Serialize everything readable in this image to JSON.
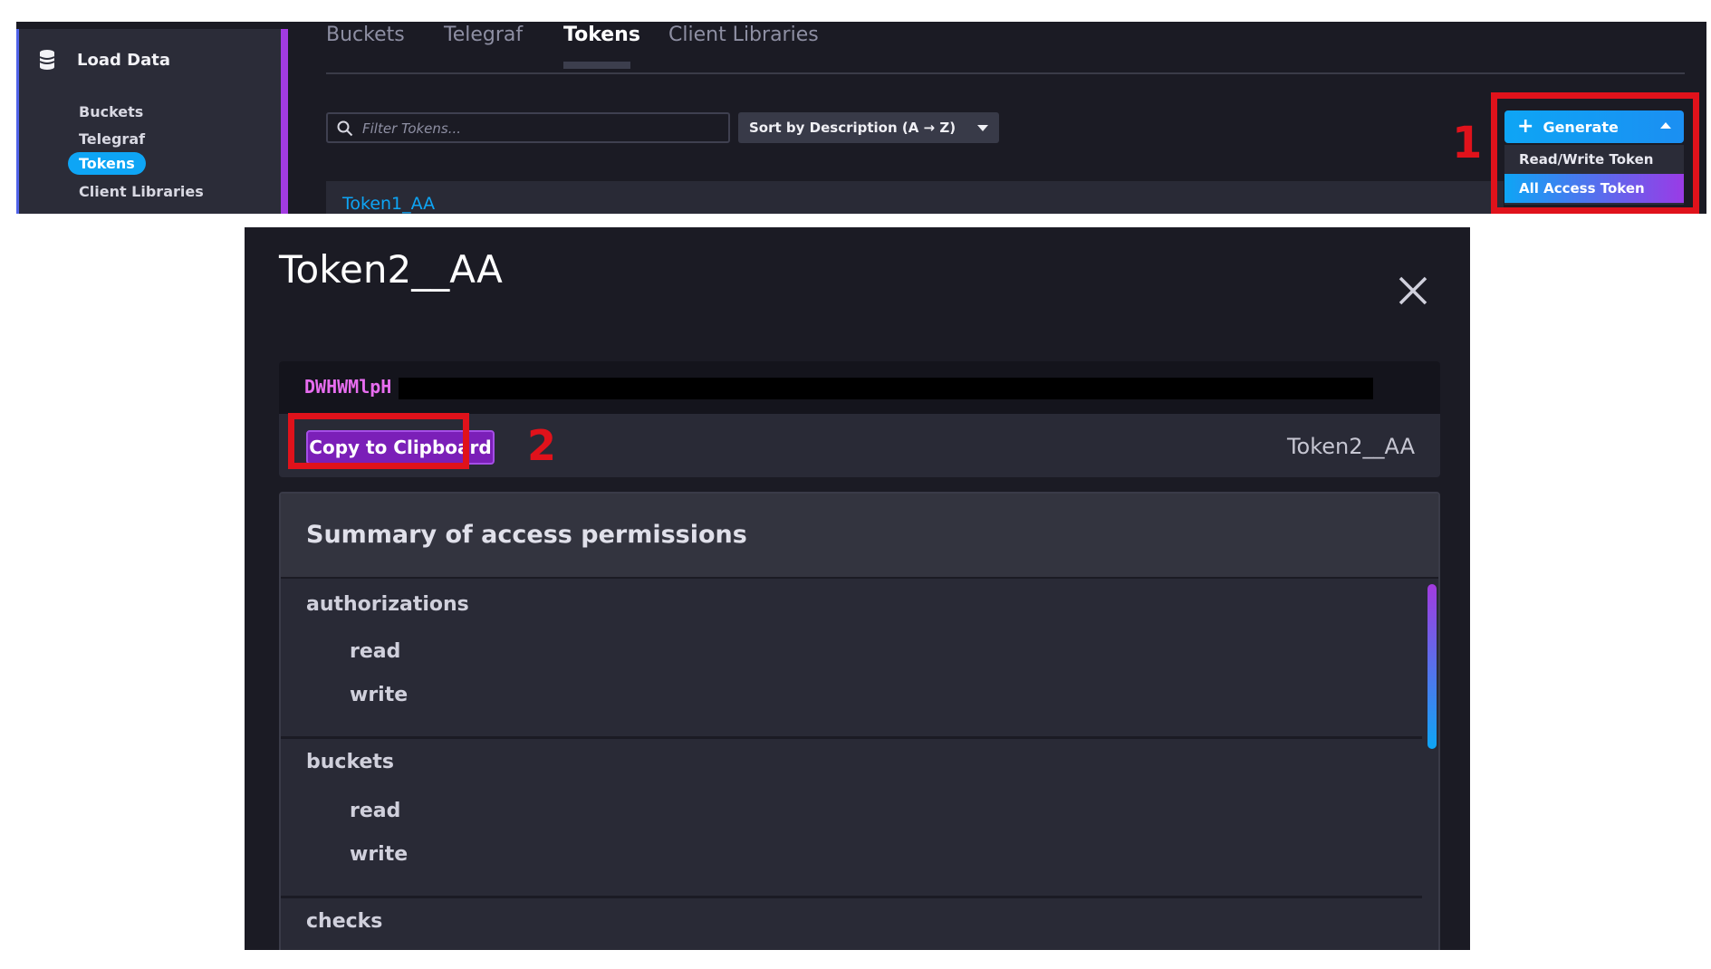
{
  "sidebar": {
    "title": "Load Data",
    "items": [
      {
        "label": "Buckets"
      },
      {
        "label": "Telegraf"
      },
      {
        "label": "Tokens"
      },
      {
        "label": "Client Libraries"
      }
    ]
  },
  "tabs": [
    {
      "label": "Buckets"
    },
    {
      "label": "Telegraf"
    },
    {
      "label": "Tokens"
    },
    {
      "label": "Client Libraries"
    }
  ],
  "filter": {
    "placeholder": "Filter Tokens..."
  },
  "sort": {
    "label": "Sort by Description (A → Z)"
  },
  "token_list": {
    "first_item": "Token1_AA"
  },
  "generate": {
    "label": "Generate",
    "options": [
      {
        "label": "Read/Write Token"
      },
      {
        "label": "All Access Token"
      }
    ]
  },
  "annotations": {
    "step1": "1",
    "step2": "2"
  },
  "modal": {
    "title": "Token2__AA",
    "token_value": "DWHWMlpH",
    "copy_label": "Copy to Clipboard",
    "description": "Token2__AA",
    "permissions_title": "Summary of access permissions",
    "permissions": [
      {
        "name": "authorizations",
        "actions": [
          "read",
          "write"
        ]
      },
      {
        "name": "buckets",
        "actions": [
          "read",
          "write"
        ]
      },
      {
        "name": "checks",
        "actions": []
      }
    ]
  },
  "colors": {
    "accent_blue": "#0ea5f5",
    "accent_purple": "#a23be0",
    "annotation_red": "#e0121b",
    "copy_button": "#7b1fb8"
  }
}
